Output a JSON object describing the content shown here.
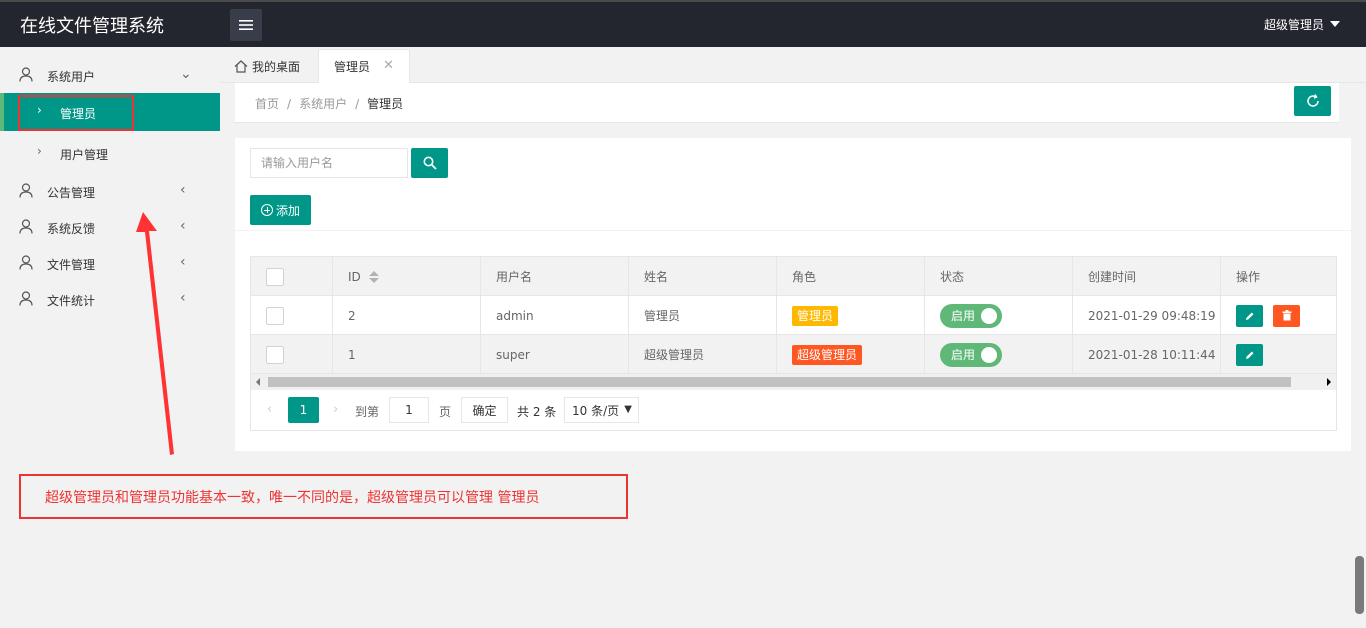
{
  "header": {
    "logo": "在线文件管理系统",
    "user": "超级管理员"
  },
  "sidebar": {
    "items": [
      {
        "label": "系统用户"
      },
      {
        "label": "公告管理"
      },
      {
        "label": "系统反馈"
      },
      {
        "label": "文件管理"
      },
      {
        "label": "文件统计"
      }
    ],
    "sub_items": [
      {
        "label": "管理员",
        "active": true
      },
      {
        "label": "用户管理",
        "active": false
      }
    ]
  },
  "tabs": [
    {
      "label": "我的桌面"
    },
    {
      "label": "管理员"
    }
  ],
  "breadcrumb": {
    "home": "首页",
    "sep": "/",
    "level1": "系统用户",
    "current": "管理员"
  },
  "search": {
    "placeholder": "请输入用户名"
  },
  "toolbar": {
    "add_label": "添加"
  },
  "table": {
    "headers": [
      "ID",
      "用户名",
      "姓名",
      "角色",
      "状态",
      "创建时间",
      "操作"
    ],
    "rows": [
      {
        "id": "2",
        "username": "admin",
        "name": "管理员",
        "role": "管理员",
        "status": "启用",
        "created": "2021-01-29 09:48:19"
      },
      {
        "id": "1",
        "username": "super",
        "name": "超级管理员",
        "role": "超级管理员",
        "status": "启用",
        "created": "2021-01-28 10:11:44"
      }
    ]
  },
  "pager": {
    "current": "1",
    "goto_label": "到第",
    "goto_value": "1",
    "page_label": "页",
    "ok_label": "确定",
    "total": "共 2 条",
    "page_size": "10 条/页"
  },
  "annotation": {
    "text": "超级管理员和管理员功能基本一致，唯一不同的是，超级管理员可以管理 管理员"
  },
  "colors": {
    "primary": "#009688",
    "header": "#23262e",
    "warning": "#ffb800",
    "danger": "#ff5722",
    "switch": "#5fb878",
    "annotation": "#e33333"
  }
}
